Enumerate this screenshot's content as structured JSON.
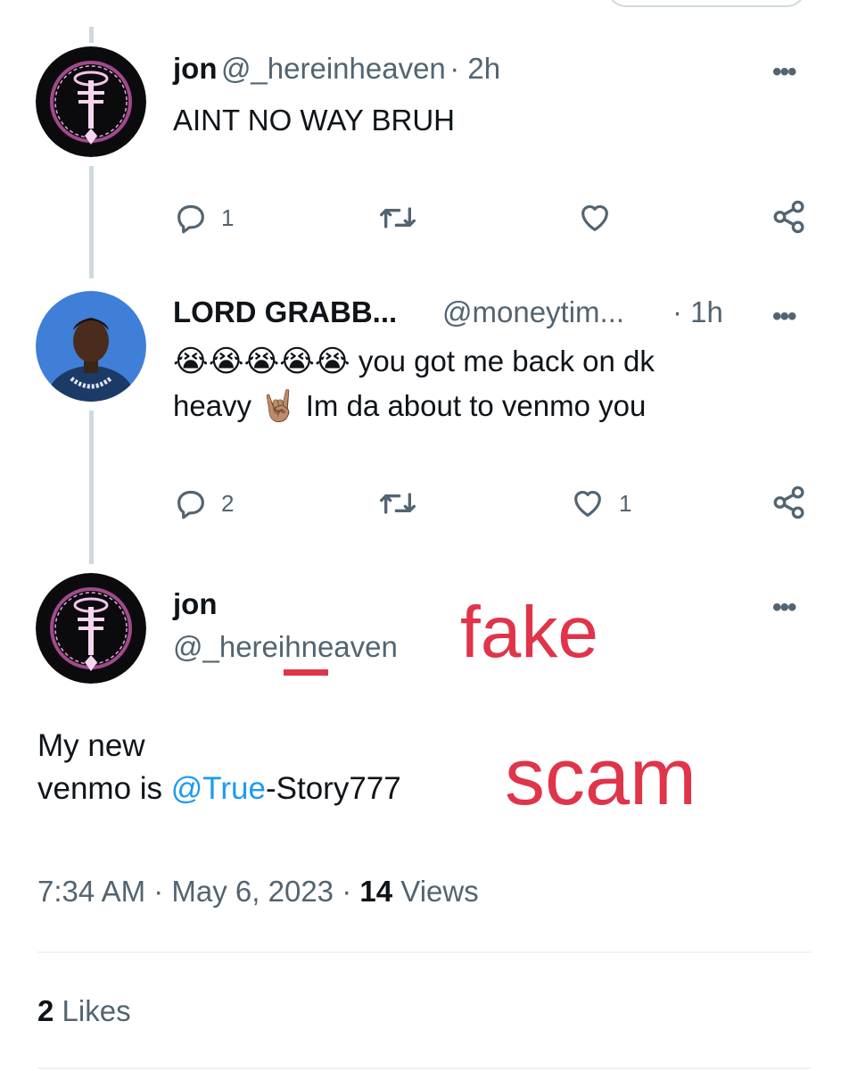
{
  "tweet1": {
    "name": "jon",
    "handle": "@_hereinheaven",
    "time": "· 2h",
    "text": "AINT NO WAY BRUH",
    "replies": "1",
    "likes": ""
  },
  "tweet2": {
    "name": "LORD GRABB...",
    "handle": "@moneytim...",
    "time": "· 1h",
    "emojis": "😭😭😭😭😭",
    "text_a": "you got me back on dk",
    "text_b_1": "heavy",
    "hand_emoji": "🤘🏽",
    "text_b_2": "Im da about to venmo you",
    "replies": "2",
    "likes": "1"
  },
  "main": {
    "name": "jon",
    "handle": "@_hereihneaven",
    "text_line1": "My new",
    "text_line2_pre": "venmo is ",
    "mention": "@True",
    "text_line2_post": "-Story777",
    "time": "7:34 AM",
    "date": "May 6, 2023",
    "views_count": "14",
    "views_label": "Views",
    "likes_count": "2",
    "likes_label": "Likes",
    "annotation_fake": "fake",
    "annotation_scam": "scam"
  },
  "more_glyph": "•••",
  "dot_sep": "·",
  "colors": {
    "accent": "#1d9bf0",
    "annotation": "#e0344a",
    "secondary_text": "#536471"
  }
}
